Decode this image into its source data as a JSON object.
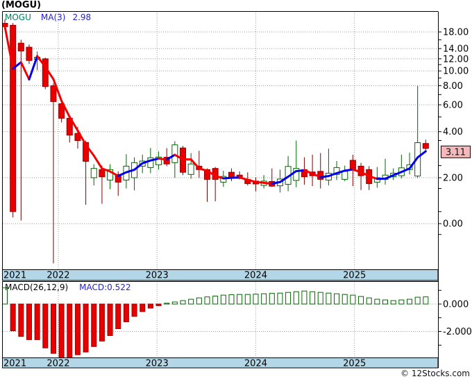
{
  "header": {
    "title": "(MOGU)"
  },
  "legend": {
    "symbol": "MOGU",
    "ma_label": "MA(3)",
    "ma_value": "2.98"
  },
  "macd_legend": {
    "label": "MACD(26,12,9)",
    "value": "MACD:0.522"
  },
  "footer": {
    "copyright": "© 12Stocks.com"
  },
  "price_flag": {
    "text": "3.11"
  },
  "colors": {
    "up": "#006600",
    "up_wick": "#006600",
    "up_fill": "#ffffff",
    "down": "#e80000",
    "down_border": "#990000",
    "down_wick": "#7b0000",
    "ma_up": "#0000ee",
    "ma_down": "#f40000",
    "grid": "#999999",
    "frame": "#000000",
    "band_bg": "#b3d7e7",
    "band_text": "#000000",
    "tick_text": "#000000",
    "price_flag_bg": "#f6b9bb",
    "price_flag_border": "#000000",
    "price_flag_text": "#111111"
  },
  "chart_data": {
    "type": "candlestick",
    "symbol": "MOGU",
    "period": "monthly",
    "overlay_ma_period": 3,
    "overlay_ma_current": 2.98,
    "current_price": 3.11,
    "macd_settings": [
      26,
      12,
      9
    ],
    "macd_current": 0.522,
    "grid": true,
    "y_axis_side": "right",
    "y_ticks": [
      {
        "label": "18.00",
        "pos": 18
      },
      {
        "label": "14.00",
        "pos": 14
      },
      {
        "label": "12.00",
        "pos": 12
      },
      {
        "label": "10.00",
        "pos": 10
      },
      {
        "label": "8.00",
        "pos": 8
      },
      {
        "label": "6.00",
        "pos": 6
      },
      {
        "label": "4.00",
        "pos": 4
      },
      {
        "label": "2.00",
        "pos": 2
      },
      {
        "label": "0.00",
        "pos": 1.0
      }
    ],
    "y_minor_ticks": [
      16,
      11,
      9,
      7,
      5,
      3.5,
      2.4,
      1.7,
      1.2,
      0.85
    ],
    "macd_ticks": [
      {
        "label": "0.000",
        "pos": 0
      },
      {
        "label": "-2.000",
        "pos": -2
      }
    ],
    "macd_minor_ticks": [
      1,
      -1,
      -3
    ],
    "years": [
      {
        "label": "2021",
        "i": -1
      },
      {
        "label": "2022",
        "i": 6.6
      },
      {
        "label": "2023",
        "i": 18.8
      },
      {
        "label": "2024",
        "i": 31.0
      },
      {
        "label": "2025",
        "i": 43.2
      }
    ],
    "candles_format": [
      "open",
      "high",
      "low",
      "close"
    ],
    "candles": [
      [
        20.5,
        21.8,
        18.5,
        19.5
      ],
      [
        19.9,
        20.6,
        1.1,
        1.2
      ],
      [
        15.2,
        16.0,
        1.05,
        13.5
      ],
      [
        14.3,
        14.9,
        11.1,
        11.7
      ],
      [
        11.9,
        13.4,
        10.1,
        12.3
      ],
      [
        12.0,
        12.2,
        7.6,
        7.9
      ],
      [
        8.0,
        8.3,
        0.55,
        6.3
      ],
      [
        6.1,
        6.4,
        4.6,
        4.9
      ],
      [
        4.9,
        5.1,
        3.4,
        3.8
      ],
      [
        3.9,
        4.3,
        3.1,
        3.5
      ],
      [
        3.4,
        3.5,
        1.33,
        2.56
      ],
      [
        2.0,
        2.45,
        1.78,
        2.3
      ],
      [
        2.26,
        2.4,
        1.35,
        2.03
      ],
      [
        1.93,
        2.45,
        1.68,
        2.26
      ],
      [
        2.1,
        2.2,
        1.52,
        1.87
      ],
      [
        1.93,
        2.85,
        1.7,
        2.38
      ],
      [
        2.0,
        2.72,
        1.65,
        2.51
      ],
      [
        2.38,
        2.83,
        2.14,
        2.57
      ],
      [
        2.33,
        3.13,
        2.14,
        2.7
      ],
      [
        2.43,
        2.97,
        2.26,
        2.73
      ],
      [
        2.72,
        3.12,
        2.38,
        2.46
      ],
      [
        2.51,
        3.47,
        2.0,
        3.28
      ],
      [
        3.13,
        3.23,
        2.08,
        2.17
      ],
      [
        2.1,
        2.9,
        1.97,
        2.46
      ],
      [
        2.38,
        3.0,
        1.99,
        2.26
      ],
      [
        2.26,
        2.3,
        1.39,
        1.95
      ],
      [
        2.3,
        2.35,
        1.4,
        1.95
      ],
      [
        1.87,
        2.22,
        1.74,
        2.04
      ],
      [
        2.17,
        2.3,
        1.9,
        2.0
      ],
      [
        2.08,
        2.2,
        1.95,
        1.98
      ],
      [
        1.95,
        2.17,
        1.78,
        1.83
      ],
      [
        1.9,
        2.0,
        1.63,
        1.82
      ],
      [
        1.78,
        2.08,
        1.7,
        1.9
      ],
      [
        1.89,
        2.3,
        1.74,
        1.76
      ],
      [
        1.77,
        2.26,
        1.6,
        1.96
      ],
      [
        1.81,
        2.77,
        1.63,
        2.37
      ],
      [
        1.92,
        3.5,
        1.73,
        2.3
      ],
      [
        2.26,
        2.72,
        1.8,
        2.03
      ],
      [
        2.18,
        2.83,
        1.76,
        2.06
      ],
      [
        2.2,
        2.9,
        1.7,
        1.95
      ],
      [
        1.93,
        3.1,
        1.78,
        2.14
      ],
      [
        2.1,
        2.57,
        1.93,
        2.33
      ],
      [
        1.95,
        2.4,
        1.9,
        2.2
      ],
      [
        2.6,
        2.83,
        1.76,
        2.26
      ],
      [
        2.38,
        2.5,
        1.66,
        2.06
      ],
      [
        2.26,
        2.38,
        1.66,
        1.83
      ],
      [
        1.87,
        2.35,
        1.72,
        2.0
      ],
      [
        1.95,
        2.66,
        1.8,
        2.08
      ],
      [
        2.03,
        2.3,
        1.93,
        2.14
      ],
      [
        2.06,
        2.83,
        1.98,
        2.32
      ],
      [
        2.26,
        2.92,
        2.1,
        2.43
      ],
      [
        2.05,
        8.0,
        1.99,
        3.39
      ],
      [
        3.35,
        3.55,
        2.95,
        3.11
      ]
    ],
    "macd_hist": [
      1.18,
      -1.95,
      -2.36,
      -2.6,
      -2.6,
      -3.2,
      -3.6,
      -3.9,
      -3.9,
      -3.7,
      -3.5,
      -3.1,
      -2.7,
      -2.3,
      -1.8,
      -1.3,
      -0.9,
      -0.55,
      -0.3,
      -0.12,
      0.06,
      0.15,
      0.25,
      0.35,
      0.45,
      0.52,
      0.58,
      0.65,
      0.68,
      0.7,
      0.7,
      0.72,
      0.75,
      0.78,
      0.8,
      0.85,
      0.9,
      0.95,
      0.9,
      0.85,
      0.8,
      0.75,
      0.7,
      0.65,
      0.55,
      0.45,
      0.35,
      0.3,
      0.25,
      0.3,
      0.35,
      0.5,
      0.522
    ]
  }
}
